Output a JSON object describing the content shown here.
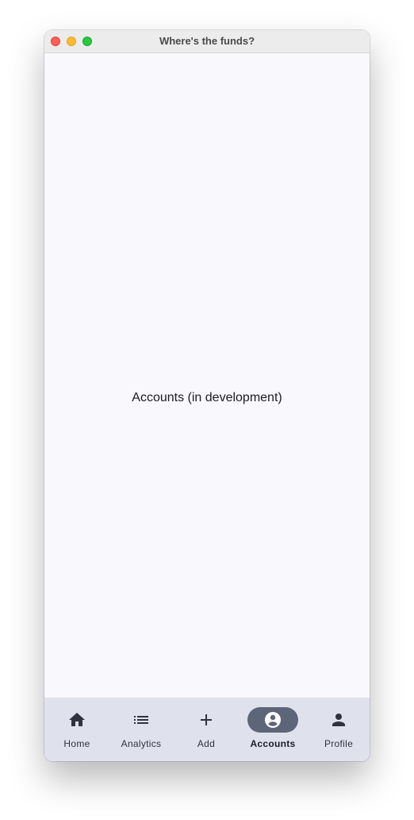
{
  "window": {
    "title": "Where's the funds?"
  },
  "main": {
    "placeholder_text": "Accounts (in development)"
  },
  "nav": {
    "items": [
      {
        "label": "Home",
        "icon": "home-icon",
        "active": false
      },
      {
        "label": "Analytics",
        "icon": "list-icon",
        "active": false
      },
      {
        "label": "Add",
        "icon": "plus-icon",
        "active": false
      },
      {
        "label": "Accounts",
        "icon": "account-circle-icon",
        "active": true
      },
      {
        "label": "Profile",
        "icon": "person-icon",
        "active": false
      }
    ]
  },
  "colors": {
    "content_background": "#f8f8fd",
    "navbar_background": "#dfe2ec",
    "active_indicator": "#5d6579",
    "icon_color": "#2f3340"
  }
}
